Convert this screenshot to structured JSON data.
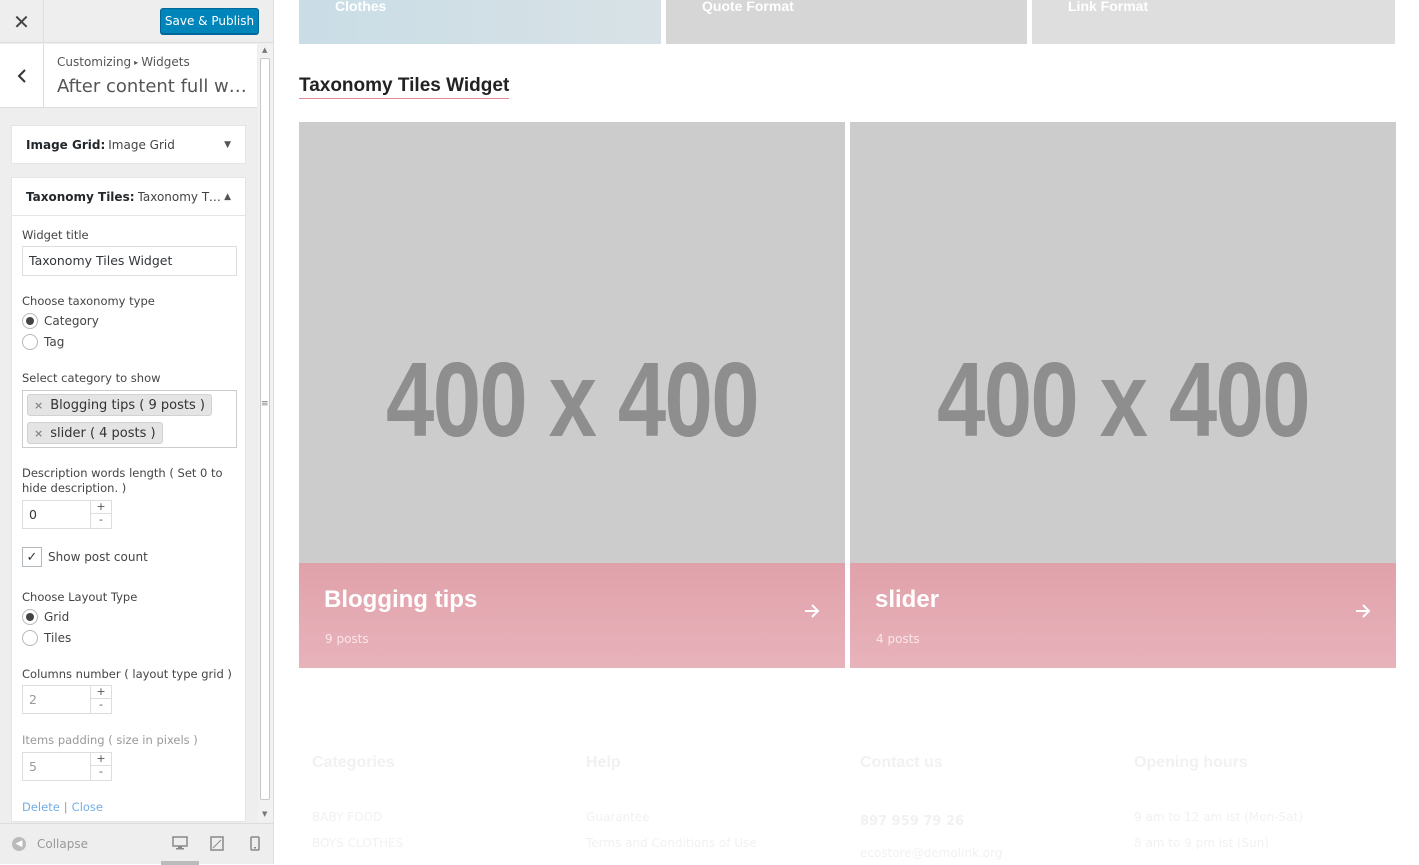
{
  "customizer": {
    "save_label": "Save & Publish",
    "breadcrumb_root": "Customizing",
    "breadcrumb_sep": "▸",
    "breadcrumb_child": "Widgets",
    "section_title": "After content full width",
    "widgets": [
      {
        "type": "Image Grid:",
        "name": "Image Grid"
      },
      {
        "type": "Taxonomy Tiles:",
        "name": "Taxonomy Tiles Widget"
      }
    ],
    "form": {
      "widget_title_label": "Widget title",
      "widget_title_value": "Taxonomy Tiles Widget",
      "taxonomy_label": "Choose taxonomy type",
      "taxonomy_options": [
        "Category",
        "Tag"
      ],
      "category_label": "Select category to show",
      "selected_categories": [
        "Blogging tips ( 9 posts )",
        "slider ( 4 posts )"
      ],
      "desc_length_label": "Description words length ( Set 0 to hide description. )",
      "desc_length_value": "0",
      "show_count_label": "Show post count",
      "layout_label": "Choose Layout Type",
      "layout_options": [
        "Grid",
        "Tiles"
      ],
      "columns_label": "Columns number ( layout type grid )",
      "columns_value": "2",
      "padding_label": "Items padding ( size in pixels )",
      "padding_value": "5",
      "delete_link": "Delete",
      "link_sep": "|",
      "close_link": "Close"
    },
    "collapse_label": "Collapse"
  },
  "preview": {
    "top_tiles": [
      "Clothes",
      "Quote Format",
      "Link Format"
    ],
    "widget_heading": "Taxonomy Tiles Widget",
    "tiles": [
      {
        "placeholder": "400 x 400",
        "title": "Blogging tips",
        "count": "9 posts"
      },
      {
        "placeholder": "400 x 400",
        "title": "slider",
        "count": "4 posts"
      }
    ],
    "footer": {
      "headings": [
        "Categories",
        "Help",
        "Contact us",
        "Opening hours"
      ],
      "categories": [
        "BABY FOOD",
        "BOYS CLOTHES"
      ],
      "help": [
        "Guarantee",
        "Terms and Conditions of Use"
      ],
      "phone": "897 959 79 26",
      "email": "ecostore@demolink.org",
      "hours": [
        "9 am to 12 am ist (Mon-Sat)",
        "8 am to 9 pm ist (Sun)"
      ]
    }
  },
  "colors": {
    "accent": "#0085ba",
    "tile_caption": "#e0a1aa",
    "placeholder_bg": "#cccccc"
  }
}
